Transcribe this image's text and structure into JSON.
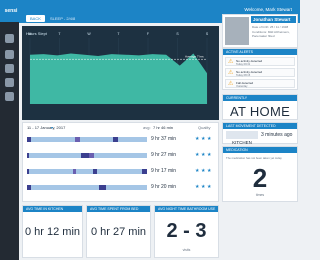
{
  "header": {
    "logo": "sensi",
    "welcome": "Welcome, Mark Stewart"
  },
  "nav": {
    "back_label": "BACK",
    "breadcrumb": "SLEEP - 2/4/8"
  },
  "chart_data": {
    "type": "area",
    "title": "Hours Slept",
    "categories": [
      "M",
      "T",
      "W",
      "T",
      "F",
      "S",
      "S"
    ],
    "values": [
      7.7,
      7.8,
      7.6,
      7.9,
      7.7,
      7.5,
      7.8,
      7.7,
      7.6,
      7.8,
      7.7,
      6.0,
      7.9,
      4.8
    ],
    "ylim": [
      0,
      10
    ],
    "average": 7.0,
    "average_label": "Average 7 hrs"
  },
  "date_range": {
    "label": "11 - 17 January, 2017",
    "avg_label": "avg:",
    "avg_value": "7 hr 46 min",
    "quality_label": "Quality"
  },
  "sleep_rows": [
    {
      "duration": "9 hr 37 min",
      "stars": 3
    },
    {
      "duration": "9 hr 27 min",
      "stars": 3
    },
    {
      "duration": "9 hr 17 min",
      "stars": 3
    },
    {
      "duration": "9 hr 20 min",
      "stars": 3
    }
  ],
  "profile": {
    "name": "Jonathan Stewart",
    "lines": [
      "Date of birth: 25 / 11 / 1938",
      "Conditions: Mild Alzheimers,",
      "Pacemaker fitted"
    ]
  },
  "alerts": {
    "title": "ACTIVE ALERTS",
    "items": [
      {
        "text": "No activity detected",
        "time": "Today 09:31"
      },
      {
        "text": "No activity detected",
        "time": "Today 08:15"
      },
      {
        "text": "Fall detected",
        "time": "Yesterday"
      }
    ]
  },
  "currently": {
    "title": "CURRENTLY",
    "value": "AT HOME"
  },
  "last_movement": {
    "title": "LAST MOVEMENT DETECTED",
    "location": "KITCHEN",
    "ago": "3 minutes ago"
  },
  "medication": {
    "title": "MEDICATION",
    "note": "The medication has not been taken yet today",
    "value": "2",
    "unit": "times"
  },
  "stats": [
    {
      "title": "AVG TIME IN KITCHEN",
      "value": "0 hr 12 min"
    },
    {
      "title": "AVG TIME SPENT FROM BED",
      "value": "0 hr 27 min"
    },
    {
      "title": "AVG NIGHT TIME BATHROOM USE",
      "value": "2 - 3",
      "unit": "visits"
    }
  ],
  "colors": {
    "brand": "#1c84c6",
    "chart_bg": "#1d3141",
    "chart_fill": "#3fb8a4",
    "alert": "#f0a72b",
    "sleep_dark": "#3b3f8f",
    "sleep_mid": "#6a5fb0",
    "sleep_light": "#a5c6e6"
  }
}
